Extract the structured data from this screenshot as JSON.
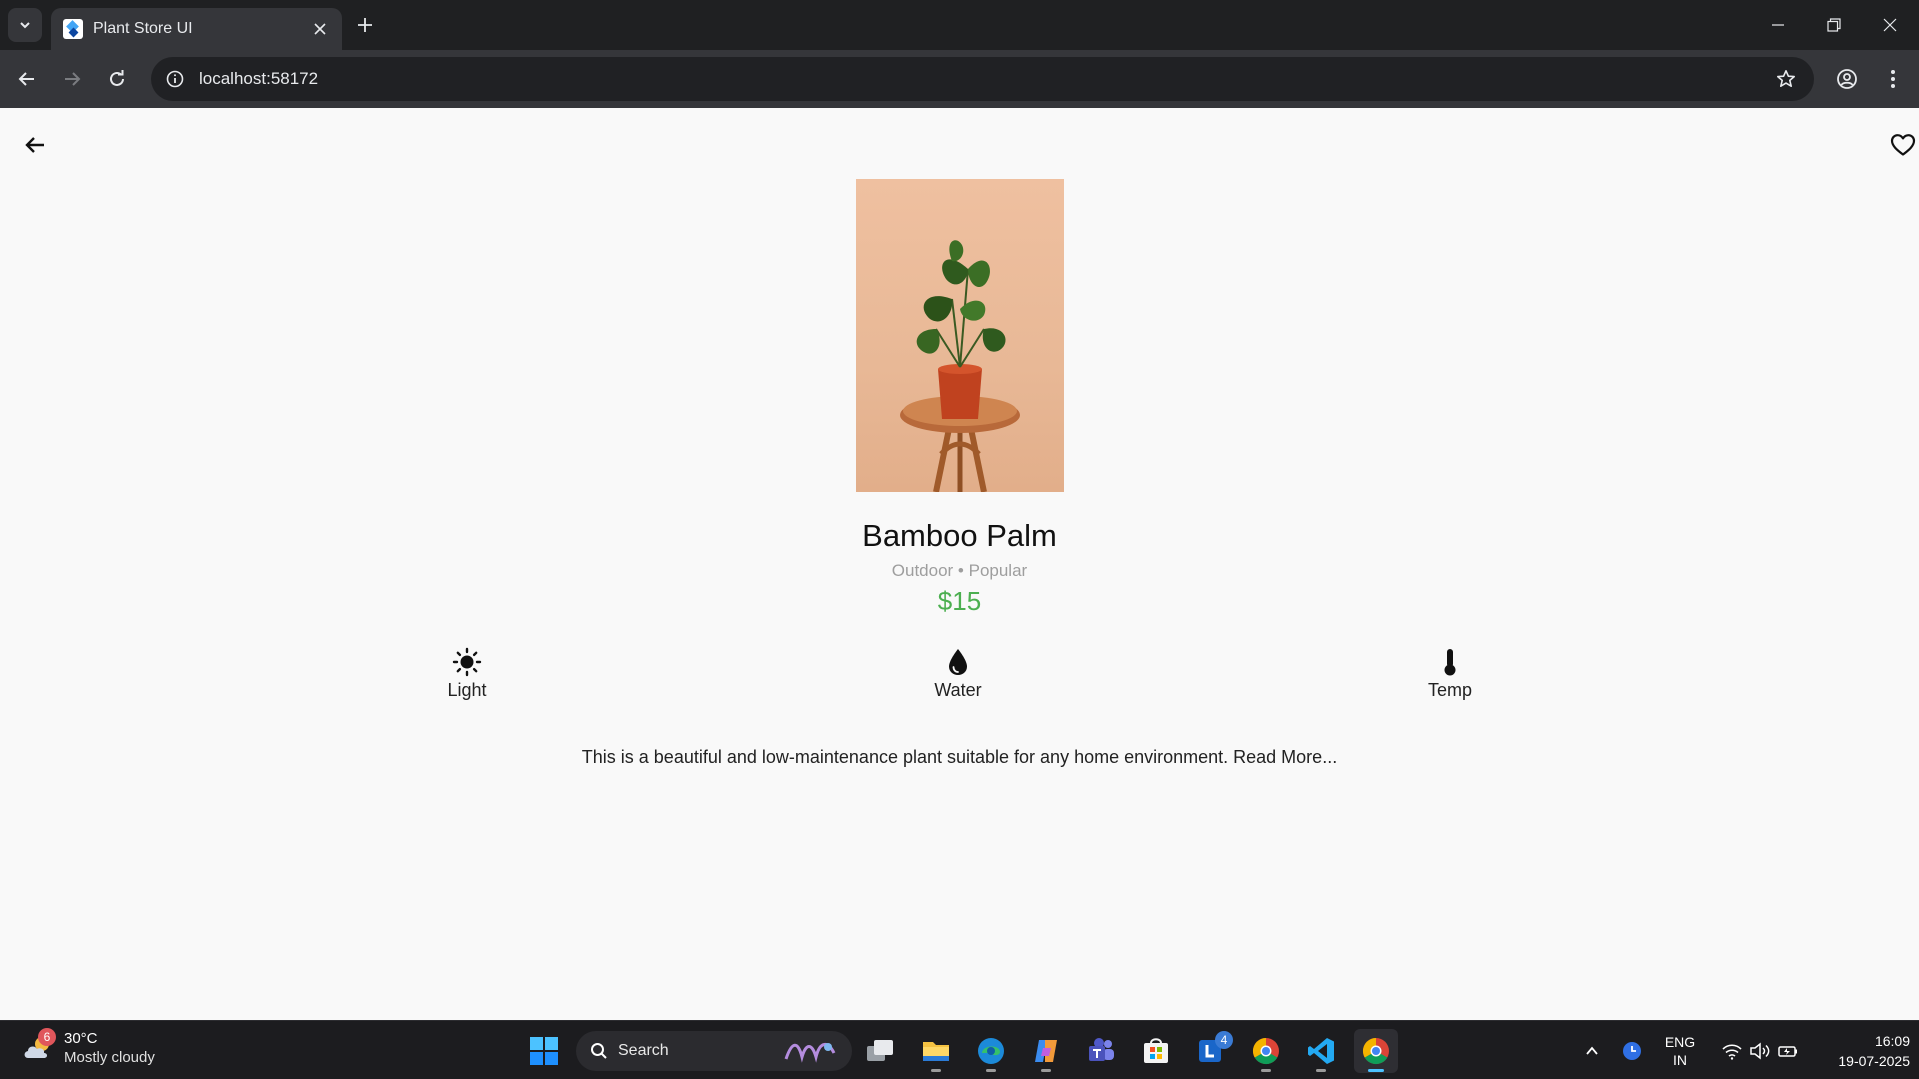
{
  "browser": {
    "tab_title": "Plant Store UI",
    "url": "localhost:58172"
  },
  "plant": {
    "name": "Bamboo Palm",
    "subtitle": "Outdoor • Popular",
    "price": "$15",
    "care": [
      {
        "label": "Light",
        "icon": "sun-icon"
      },
      {
        "label": "Water",
        "icon": "water-drop-icon"
      },
      {
        "label": "Temp",
        "icon": "thermometer-icon"
      }
    ],
    "description": "This is a beautiful and low-maintenance plant suitable for any home environment. Read More..."
  },
  "colors": {
    "price": "#4caf50",
    "background": "#f9f9f9"
  },
  "taskbar": {
    "weather_badge": "6",
    "weather_temp": "30°C",
    "weather_desc": "Mostly cloudy",
    "search_label": "Search",
    "lang_top": "ENG",
    "lang_bottom": "IN",
    "time": "16:09",
    "date": "19-07-2025",
    "outlook_badge": "4"
  }
}
